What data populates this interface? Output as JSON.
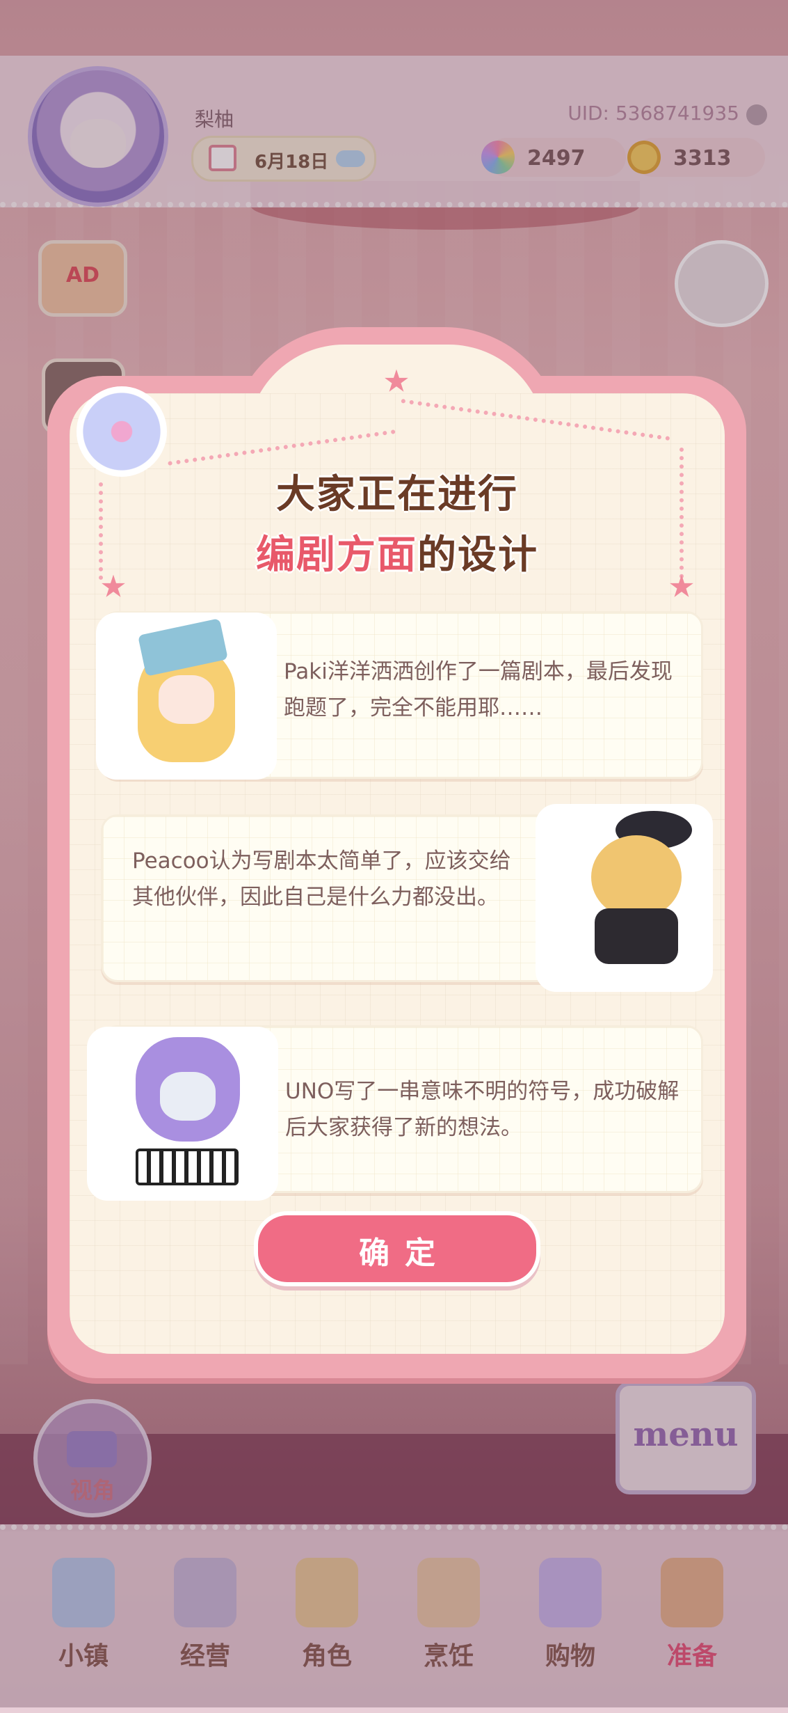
{
  "header": {
    "player_name": "梨柚",
    "uid": "UID: 5368741935",
    "date": "6月18日",
    "gems": "2497",
    "coins": "3313"
  },
  "side": {
    "ad_label": "AD",
    "camera_label": "视角",
    "menu_label": "menu"
  },
  "modal": {
    "title_line1": "大家正在进行",
    "title_line2_highlight": "编剧方面",
    "title_line2_rest": "的设计",
    "entries": [
      {
        "text": "Paki洋洋洒洒创作了一篇剧本，最后发现跑题了，完全不能用耶……"
      },
      {
        "text": "Peacoo认为写剧本太简单了，应该交给其他伙伴，因此自己是什么力都没出。"
      },
      {
        "text": "UNO写了一串意味不明的符号，成功破解后大家获得了新的想法。"
      }
    ],
    "confirm_label": "确定"
  },
  "nav": [
    {
      "label": "小镇",
      "icon": "map-icon"
    },
    {
      "label": "经营",
      "icon": "shop-bag-icon"
    },
    {
      "label": "角色",
      "icon": "character-icon"
    },
    {
      "label": "烹饪",
      "icon": "sandwich-icon"
    },
    {
      "label": "购物",
      "icon": "shopping-bag-icon"
    },
    {
      "label": "准备",
      "icon": "basket-icon"
    }
  ],
  "colors": {
    "accent_pink": "#f06c85",
    "title_brown": "#6a3b26",
    "title_highlight": "#e8596a",
    "nav_active": "#e4557a"
  }
}
